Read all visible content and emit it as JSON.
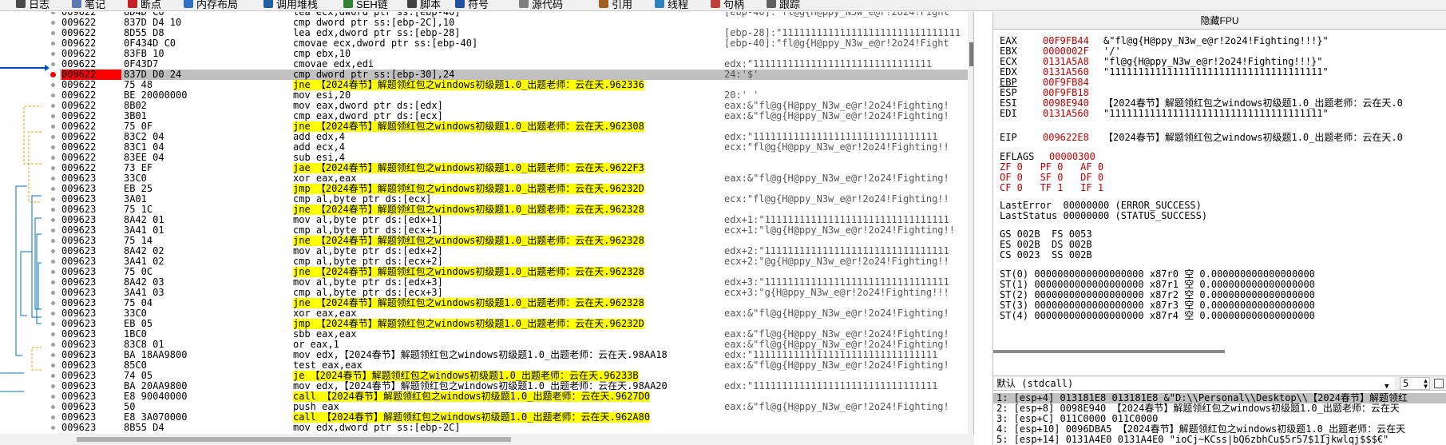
{
  "tabs": [
    {
      "label": "日志",
      "color": "#4a4a4a"
    },
    {
      "label": "笔记",
      "color": "#5a7ab0"
    },
    {
      "label": "断点",
      "color": "#c02020"
    },
    {
      "label": "内存布局",
      "color": "#3070c0"
    },
    {
      "label": "调用堆栈",
      "color": "#2060a0"
    },
    {
      "label": "SEH链",
      "color": "#308030"
    },
    {
      "label": "脚本",
      "color": "#404040"
    },
    {
      "label": "符号",
      "color": "#2050a0"
    },
    {
      "label": "源代码",
      "color": "#808080"
    },
    {
      "label": "引用",
      "color": "#a06020"
    },
    {
      "label": "线程",
      "color": "#3080c0"
    },
    {
      "label": "句柄",
      "color": "#c04040"
    },
    {
      "label": "跟踪",
      "color": "#606060"
    }
  ],
  "disasm": [
    {
      "addr": "009622",
      "hex": "8D4D C0",
      "asm": "lea ecx,dword ptr ss:[ebp-40]",
      "cmt": "[ebp-40]:\"fl@g{H@ppy_N3w_e@r!2o24!Fight"
    },
    {
      "addr": "009622",
      "hex": "837D D4 10",
      "asm": "cmp dword ptr ss:[ebp-2C],10",
      "cmt": ""
    },
    {
      "addr": "009622",
      "hex": "8D55 D8",
      "asm": "lea edx,dword ptr ss:[ebp-28]",
      "cmt": "[ebp-28]:\"1111111111111111111111111111111"
    },
    {
      "addr": "009622",
      "hex": "0F434D C0",
      "asm": "cmovae ecx,dword ptr ss:[ebp-40]",
      "cmt": "[ebp-40]:\"fl@g{H@ppy_N3w_e@r!2o24!Fight"
    },
    {
      "addr": "009622",
      "hex": "83FB 10",
      "asm": "cmp ebx,10",
      "cmt": ""
    },
    {
      "addr": "009622",
      "hex": "0F43D7",
      "asm": "cmovae edx,edi",
      "cmt": "edx:\"1111111111111111111111111111111"
    },
    {
      "addr": "009622",
      "hex": "837D D0 24",
      "asm": "cmp dword ptr ss:[ebp-30],24",
      "cmt": "24:'$'",
      "sel": true
    },
    {
      "addr": "009622",
      "hex": "75 48",
      "asm": "jne 【2024春节】解题领红包之windows初级题1.0_出题老师：云在天.962336",
      "cmt": "",
      "jump": true
    },
    {
      "addr": "009622",
      "hex": "BE 20000000",
      "asm": "mov esi,20",
      "cmt": "20:' '"
    },
    {
      "addr": "009622",
      "hex": "8B02",
      "asm": "mov eax,dword ptr ds:[edx]",
      "cmt": "eax:&\"fl@g{H@ppy_N3w_e@r!2o24!Fighting!"
    },
    {
      "addr": "009622",
      "hex": "3B01",
      "asm": "cmp eax,dword ptr ds:[ecx]",
      "cmt": "eax:&\"fl@g{H@ppy_N3w_e@r!2o24!Fighting!"
    },
    {
      "addr": "009622",
      "hex": "75 0F",
      "asm": "jne 【2024春节】解题领红包之windows初级题1.0_出题老师：云在天.962308",
      "cmt": "",
      "jump": true
    },
    {
      "addr": "009622",
      "hex": "83C2 04",
      "asm": "add edx,4",
      "cmt": "edx:\"11111111111111111111111111111111"
    },
    {
      "addr": "009622",
      "hex": "83C1 04",
      "asm": "add ecx,4",
      "cmt": "ecx:\"fl@g{H@ppy_N3w_e@r!2o24!Fighting!!"
    },
    {
      "addr": "009622",
      "hex": "83EE 04",
      "asm": "sub esi,4",
      "cmt": ""
    },
    {
      "addr": "009622",
      "hex": "73 EF",
      "asm": "jae 【2024春节】解题领红包之windows初级题1.0_出题老师：云在天.9622F3",
      "cmt": "",
      "jump": true
    },
    {
      "addr": "009623",
      "hex": "33C0",
      "asm": "xor eax,eax",
      "cmt": "eax:&\"fl@g{H@ppy_N3w_e@r!2o24!Fighting!"
    },
    {
      "addr": "009623",
      "hex": "EB 25",
      "asm": "jmp 【2024春节】解题领红包之windows初级题1.0_出题老师：云在天.96232D",
      "cmt": "",
      "jump": true
    },
    {
      "addr": "009623",
      "hex": "3A01",
      "asm": "cmp al,byte ptr ds:[ecx]",
      "cmt": "ecx:\"fl@g{H@ppy_N3w_e@r!2o24!Fighting!!"
    },
    {
      "addr": "009623",
      "hex": "75 1C",
      "asm": "jne 【2024春节】解题领红包之windows初级题1.0_出题老师：云在天.962328",
      "cmt": "",
      "jump": true
    },
    {
      "addr": "009623",
      "hex": "8A42 01",
      "asm": "mov al,byte ptr ds:[edx+1]",
      "cmt": "edx+1:\"11111111111111111111111111111111"
    },
    {
      "addr": "009623",
      "hex": "3A41 01",
      "asm": "cmp al,byte ptr ds:[ecx+1]",
      "cmt": "ecx+1:\"l@g{H@ppy_N3w_e@r!2o24!Fighting!!"
    },
    {
      "addr": "009623",
      "hex": "75 14",
      "asm": "jne 【2024春节】解题领红包之windows初级题1.0_出题老师：云在天.962328",
      "cmt": "",
      "jump": true
    },
    {
      "addr": "009623",
      "hex": "8A42 02",
      "asm": "mov al,byte ptr ds:[edx+2]",
      "cmt": "edx+2:\"11111111111111111111111111111111"
    },
    {
      "addr": "009623",
      "hex": "3A41 02",
      "asm": "cmp al,byte ptr ds:[ecx+2]",
      "cmt": "ecx+2:\"@g{H@ppy_N3w_e@r!2o24!Fighting!!"
    },
    {
      "addr": "009623",
      "hex": "75 0C",
      "asm": "jne 【2024春节】解题领红包之windows初级题1.0_出题老师：云在天.962328",
      "cmt": "",
      "jump": true
    },
    {
      "addr": "009623",
      "hex": "8A42 03",
      "asm": "mov al,byte ptr ds:[edx+3]",
      "cmt": "edx+3:\"11111111111111111111111111111111"
    },
    {
      "addr": "009623",
      "hex": "3A41 03",
      "asm": "cmp al,byte ptr ds:[ecx+3]",
      "cmt": "ecx+3:\"g{H@ppy_N3w_e@r!2o24!Fighting!!!"
    },
    {
      "addr": "009623",
      "hex": "75 04",
      "asm": "jne 【2024春节】解题领红包之windows初级题1.0_出题老师：云在天.962328",
      "cmt": "",
      "jump": true
    },
    {
      "addr": "009623",
      "hex": "33C0",
      "asm": "xor eax,eax",
      "cmt": "eax:&\"fl@g{H@ppy_N3w_e@r!2o24!Fighting!"
    },
    {
      "addr": "009623",
      "hex": "EB 05",
      "asm": "jmp 【2024春节】解题领红包之windows初级题1.0_出题老师：云在天.96232D",
      "cmt": "",
      "jump": true
    },
    {
      "addr": "009623",
      "hex": "1BC0",
      "asm": "sbb eax,eax",
      "cmt": "eax:&\"fl@g{H@ppy_N3w_e@r!2o24!Fighting!"
    },
    {
      "addr": "009623",
      "hex": "83C8 01",
      "asm": "or eax,1",
      "cmt": "eax:&\"fl@g{H@ppy_N3w_e@r!2o24!Fighting!"
    },
    {
      "addr": "009623",
      "hex": "BA 18AA9800",
      "asm": "mov edx,【2024春节】解题领红包之windows初级题1.0_出题老师：云在天.98AA18",
      "cmt": "edx:\"11111111111111111111111111111111"
    },
    {
      "addr": "009623",
      "hex": "85C0",
      "asm": "test eax,eax",
      "cmt": "eax:&\"fl@g{H@ppy_N3w_e@r!2o24!Fighting!"
    },
    {
      "addr": "009623",
      "hex": "74 05",
      "asm": "je 【2024春节】解题领红包之windows初级题1.0_出题老师：云在天.96233B",
      "cmt": "",
      "jump": true
    },
    {
      "addr": "009623",
      "hex": "BA 20AA9800",
      "asm": "mov edx,【2024春节】解题领红包之windows初级题1.0_出题老师：云在天.98AA20",
      "cmt": "edx:\"11111111111111111111111111111111"
    },
    {
      "addr": "009623",
      "hex": "E8 90040000",
      "asm": "call 【2024春节】解题领红包之windows初级题1.0_出题老师：云在天.9627D0",
      "cmt": "",
      "call": true
    },
    {
      "addr": "009623",
      "hex": "50",
      "asm": "push eax",
      "cmt": "eax:&\"fl@g{H@ppy_N3w_e@r!2o24!Fighting!"
    },
    {
      "addr": "009623",
      "hex": "E8 3A070000",
      "asm": "call 【2024春节】解题领红包之windows初级题1.0_出题老师：云在天.962A80",
      "cmt": "",
      "call": true
    },
    {
      "addr": "009623",
      "hex": "8B55 D4",
      "asm": "mov edx,dword ptr ss:[ebp-2C]",
      "cmt": ""
    }
  ],
  "fpu": {
    "title": "隐藏FPU",
    "regs": [
      {
        "n": "EAX",
        "v": "00F9FB44",
        "d": "&\"fl@g{H@ppy_N3w_e@r!2o24!Fighting!!!}\""
      },
      {
        "n": "EBX",
        "v": "0000002F",
        "d": "'/'"
      },
      {
        "n": "ECX",
        "v": "0131A5A8",
        "d": "\"fl@g{H@ppy_N3w_e@r!2o24!Fighting!!!}\""
      },
      {
        "n": "EDX",
        "v": "0131A560",
        "d": "\"1111111111111111111111111111111111111\""
      },
      {
        "n": "EBP",
        "v": "00F9FB84",
        "d": ""
      },
      {
        "n": "ESP",
        "v": "00F9FB18",
        "d": ""
      },
      {
        "n": "ESI",
        "v": "0098E940",
        "d": "【2024春节】解题领红包之windows初级题1.0_出题老师：云在天.0"
      },
      {
        "n": "EDI",
        "v": "0131A560",
        "d": "\"1111111111111111111111111111111111111\""
      }
    ],
    "eip": {
      "n": "EIP",
      "v": "009622E8",
      "d": "【2024春节】解题领红包之windows初级题1.0_出题老师：云在天.0"
    },
    "eflags": {
      "n": "EFLAGS",
      "v": "00000300"
    },
    "flags1": "ZF 0   PF 0   AF 0",
    "flags2": "OF 0   SF 0   DF 0",
    "flags3": "CF 0   TF 1   IF 1",
    "lasterror": "LastError  00000000 (ERROR_SUCCESS)",
    "laststatus": "LastStatus 00000000 (STATUS_SUCCESS)",
    "seg1": "GS 002B  FS 0053",
    "seg2": "ES 002B  DS 002B",
    "seg3": "CS 0023  SS 002B",
    "st": [
      "ST(0) 0000000000000000000 x87r0 空 0.000000000000000000",
      "ST(1) 0000000000000000000 x87r1 空 0.000000000000000000",
      "ST(2) 0000000000000000000 x87r2 空 0.000000000000000000",
      "ST(3) 0000000000000000000 x87r3 空 0.000000000000000000",
      "ST(4) 0000000000000000000 x87r4 空 0.000000000000000000"
    ]
  },
  "callconv": {
    "value": "默认 (stdcall)",
    "count": "5"
  },
  "args": [
    "1: [esp+4] 013181E8 013181E8 &\"D:\\\\Personal\\\\Desktop\\\\【2024春节】解题领红",
    "2: [esp+8] 0098E940 【2024春节】解题领红包之windows初级题1.0_出题老师：云在天",
    "3: [esp+C] 011C0000 011C0000",
    "4: [esp+10] 0096DBA5 【2024春节】解题领红包之windows初级题1.0_出题老师：云在天",
    "5: [esp+14] 0131A4E0 0131A4E0 \"ioCj~KCss|bQ6zbhCu$5r57$1Ijkwlqj$$$€\""
  ]
}
